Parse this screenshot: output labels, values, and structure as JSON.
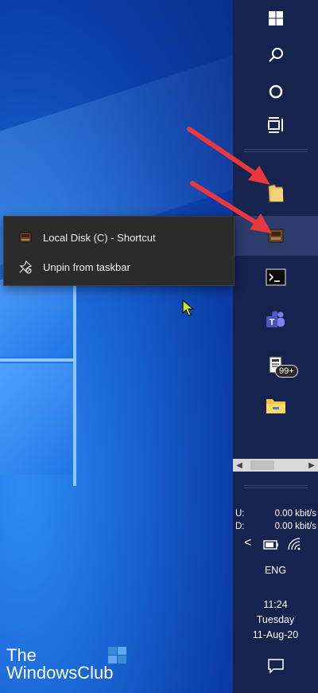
{
  "colors": {
    "taskbar": "#17234f",
    "context_menu": "#2b2b2b",
    "arrow": "#e8373d",
    "cursor": "#c8e632"
  },
  "taskbar": {
    "items": [
      {
        "icon": "windows-start-icon"
      },
      {
        "icon": "search-icon"
      },
      {
        "icon": "cortana-circle-icon"
      },
      {
        "icon": "task-view-icon"
      },
      {
        "icon": "folder-icon"
      },
      {
        "icon": "local-disk-shortcut-icon"
      },
      {
        "icon": "terminal-icon"
      },
      {
        "icon": "teams-icon"
      },
      {
        "icon": "document-app-icon",
        "badge": "99+"
      },
      {
        "icon": "file-explorer-icon"
      }
    ],
    "scrollbar": {
      "left": "◀",
      "right": "▶"
    },
    "network": {
      "up_label": "U:",
      "up_value": "0.00 kbit/s",
      "down_label": "D:",
      "down_value": "0.00 kbit/s"
    },
    "tray_chevron": "<",
    "language": "ENG",
    "time": "11:24",
    "day": "Tuesday",
    "date": "11-Aug-20"
  },
  "context_menu": {
    "item1": "Local Disk (C) - Shortcut",
    "item2": "Unpin from taskbar"
  },
  "watermark": {
    "line1": "The",
    "line2": "WindowsClub"
  }
}
